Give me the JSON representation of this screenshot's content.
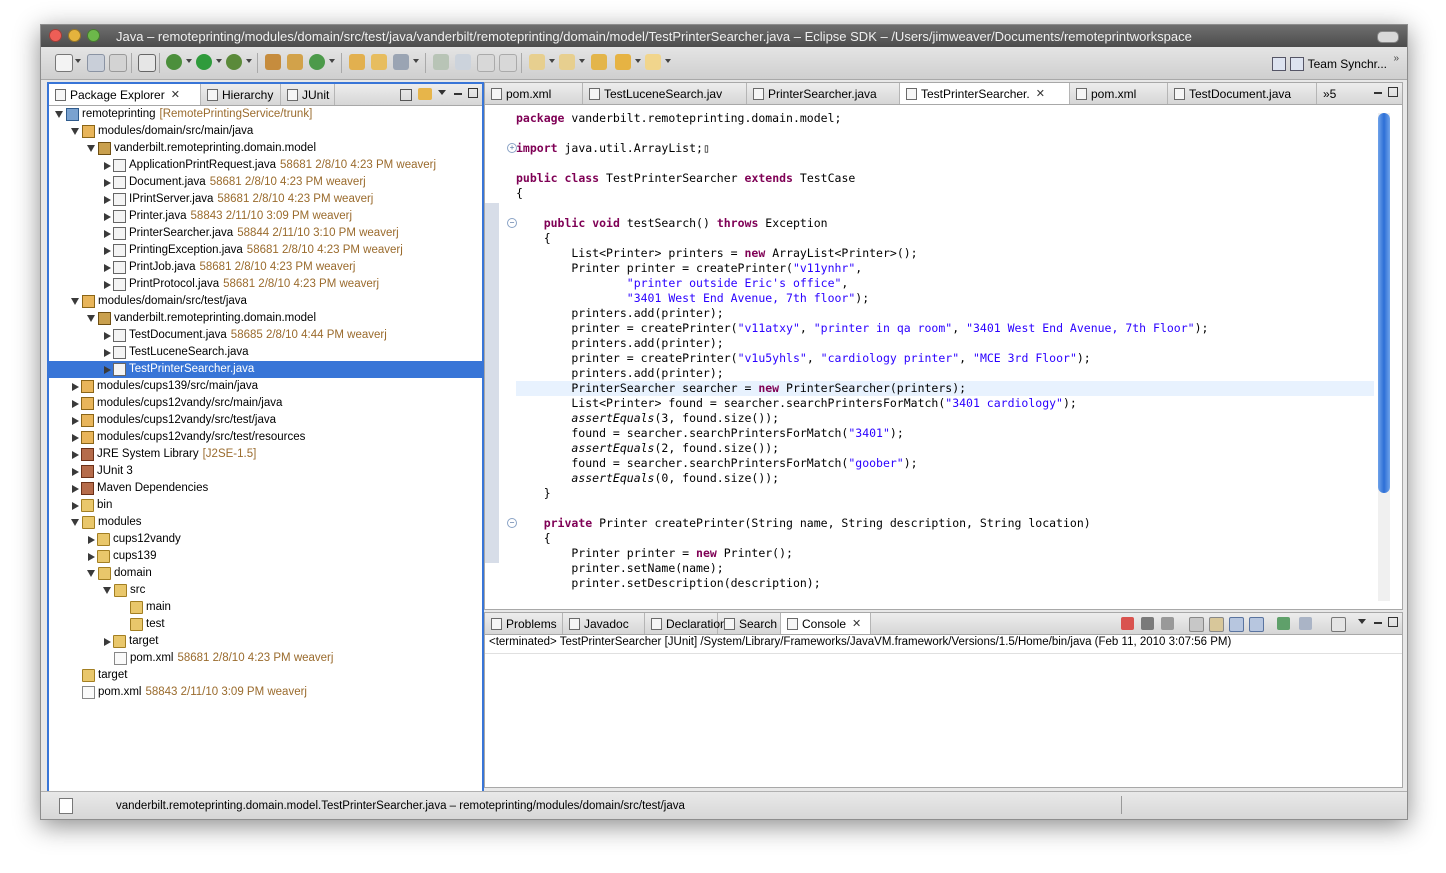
{
  "window": {
    "title": "Java – remoteprinting/modules/domain/src/test/java/vanderbilt/remoteprinting/domain/model/TestPrinterSearcher.java – Eclipse SDK – /Users/jimweaver/Documents/remoteprintworkspace"
  },
  "toolbar": {
    "team_sync_label": "Team Synchr...",
    "chevron": "»"
  },
  "left_tabs": [
    {
      "label": "Package Explorer",
      "active": true
    },
    {
      "label": "Hierarchy",
      "active": false
    },
    {
      "label": "JUnit",
      "active": false
    }
  ],
  "tree": [
    {
      "label": "remoteprinting",
      "deco": "[RemotePrintingService/trunk]",
      "depth": 0,
      "twisty": "open",
      "icon": "proj"
    },
    {
      "label": "modules/domain/src/main/java",
      "deco": "",
      "depth": 1,
      "twisty": "open",
      "icon": "pkgfolder"
    },
    {
      "label": "vanderbilt.remoteprinting.domain.model",
      "deco": "",
      "depth": 2,
      "twisty": "open",
      "icon": "pkg"
    },
    {
      "label": "ApplicationPrintRequest.java",
      "deco": "58681  2/8/10 4:23 PM  weaverj",
      "depth": 3,
      "twisty": "closed",
      "icon": "java"
    },
    {
      "label": "Document.java",
      "deco": "58681  2/8/10 4:23 PM  weaverj",
      "depth": 3,
      "twisty": "closed",
      "icon": "java"
    },
    {
      "label": "IPrintServer.java",
      "deco": "58681  2/8/10 4:23 PM  weaverj",
      "depth": 3,
      "twisty": "closed",
      "icon": "java"
    },
    {
      "label": "Printer.java",
      "deco": "58843  2/11/10 3:09 PM  weaverj",
      "depth": 3,
      "twisty": "closed",
      "icon": "java"
    },
    {
      "label": "PrinterSearcher.java",
      "deco": "58844  2/11/10 3:10 PM  weaverj",
      "depth": 3,
      "twisty": "closed",
      "icon": "java"
    },
    {
      "label": "PrintingException.java",
      "deco": "58681  2/8/10 4:23 PM  weaverj",
      "depth": 3,
      "twisty": "closed",
      "icon": "java"
    },
    {
      "label": "PrintJob.java",
      "deco": "58681  2/8/10 4:23 PM  weaverj",
      "depth": 3,
      "twisty": "closed",
      "icon": "java"
    },
    {
      "label": "PrintProtocol.java",
      "deco": "58681  2/8/10 4:23 PM  weaverj",
      "depth": 3,
      "twisty": "closed",
      "icon": "java"
    },
    {
      "label": "modules/domain/src/test/java",
      "deco": "",
      "depth": 1,
      "twisty": "open",
      "icon": "pkgfolder"
    },
    {
      "label": "vanderbilt.remoteprinting.domain.model",
      "deco": "",
      "depth": 2,
      "twisty": "open",
      "icon": "pkg"
    },
    {
      "label": "TestDocument.java",
      "deco": "58685  2/8/10 4:44 PM  weaverj",
      "depth": 3,
      "twisty": "closed",
      "icon": "java"
    },
    {
      "label": "TestLuceneSearch.java",
      "deco": "",
      "depth": 3,
      "twisty": "closed",
      "icon": "java"
    },
    {
      "label": "TestPrinterSearcher.java",
      "deco": "",
      "depth": 3,
      "twisty": "closed",
      "icon": "java",
      "selected": true
    },
    {
      "label": "modules/cups139/src/main/java",
      "deco": "",
      "depth": 1,
      "twisty": "closed",
      "icon": "pkgfolder"
    },
    {
      "label": "modules/cups12vandy/src/main/java",
      "deco": "",
      "depth": 1,
      "twisty": "closed",
      "icon": "pkgfolder"
    },
    {
      "label": "modules/cups12vandy/src/test/java",
      "deco": "",
      "depth": 1,
      "twisty": "closed",
      "icon": "pkgfolder"
    },
    {
      "label": "modules/cups12vandy/src/test/resources",
      "deco": "",
      "depth": 1,
      "twisty": "closed",
      "icon": "pkgfolder"
    },
    {
      "label": "JRE System Library",
      "deco": "[J2SE-1.5]",
      "depth": 1,
      "twisty": "closed",
      "icon": "lib"
    },
    {
      "label": "JUnit 3",
      "deco": "",
      "depth": 1,
      "twisty": "closed",
      "icon": "lib"
    },
    {
      "label": "Maven Dependencies",
      "deco": "",
      "depth": 1,
      "twisty": "closed",
      "icon": "lib"
    },
    {
      "label": "bin",
      "deco": "",
      "depth": 1,
      "twisty": "closed",
      "icon": "folder"
    },
    {
      "label": "modules",
      "deco": "",
      "depth": 1,
      "twisty": "open",
      "icon": "folder"
    },
    {
      "label": "cups12vandy",
      "deco": "",
      "depth": 2,
      "twisty": "closed",
      "icon": "folder"
    },
    {
      "label": "cups139",
      "deco": "",
      "depth": 2,
      "twisty": "closed",
      "icon": "folder"
    },
    {
      "label": "domain",
      "deco": "",
      "depth": 2,
      "twisty": "open",
      "icon": "folder"
    },
    {
      "label": "src",
      "deco": "",
      "depth": 3,
      "twisty": "open",
      "icon": "folder"
    },
    {
      "label": "main",
      "deco": "",
      "depth": 4,
      "twisty": "none",
      "icon": "folder"
    },
    {
      "label": "test",
      "deco": "",
      "depth": 4,
      "twisty": "none",
      "icon": "folder"
    },
    {
      "label": "target",
      "deco": "",
      "depth": 3,
      "twisty": "closed",
      "icon": "folder"
    },
    {
      "label": "pom.xml",
      "deco": "58681  2/8/10 4:23 PM  weaverj",
      "depth": 3,
      "twisty": "none",
      "icon": "xml"
    },
    {
      "label": "target",
      "deco": "",
      "depth": 1,
      "twisty": "none",
      "icon": "folder"
    },
    {
      "label": "pom.xml",
      "deco": "58843  2/11/10 3:09 PM  weaverj",
      "depth": 1,
      "twisty": "none",
      "icon": "xml"
    }
  ],
  "editor_tabs": [
    {
      "label": "pom.xml",
      "active": false
    },
    {
      "label": "TestLuceneSearch.jav",
      "active": false
    },
    {
      "label": "PrinterSearcher.java",
      "active": false
    },
    {
      "label": "TestPrinterSearcher.",
      "active": true
    },
    {
      "label": "pom.xml",
      "active": false
    },
    {
      "label": "TestDocument.java",
      "active": false
    }
  ],
  "editor_overflow": "»5",
  "code_lines": [
    {
      "html": "<span class=\"kw\">package</span> vanderbilt.remoteprinting.domain.model;"
    },
    {
      "html": ""
    },
    {
      "html": "<span class=\"kw\">import</span> java.util.ArrayList;▯",
      "fold": "plus"
    },
    {
      "html": ""
    },
    {
      "html": "<span class=\"kw\">public</span> <span class=\"kw\">class</span> TestPrinterSearcher <span class=\"kw\">extends</span> TestCase"
    },
    {
      "html": "{"
    },
    {
      "html": ""
    },
    {
      "html": "    <span class=\"kw\">public</span> <span class=\"kw\">void</span> testSearch() <span class=\"kw\">throws</span> Exception",
      "fold": "minus"
    },
    {
      "html": "    {"
    },
    {
      "html": "        List&lt;Printer&gt; printers = <span class=\"kw\">new</span> ArrayList&lt;Printer&gt;();"
    },
    {
      "html": "        Printer printer = createPrinter(<span class=\"str\">\"v11ynhr\"</span>,"
    },
    {
      "html": "                <span class=\"str\">\"printer outside Eric's office\"</span>,"
    },
    {
      "html": "                <span class=\"str\">\"3401 West End Avenue, 7th floor\"</span>);"
    },
    {
      "html": "        printers.add(printer);"
    },
    {
      "html": "        printer = createPrinter(<span class=\"str\">\"v11atxy\"</span>, <span class=\"str\">\"printer in qa room\"</span>, <span class=\"str\">\"3401 West End Avenue, 7th Floor\"</span>);"
    },
    {
      "html": "        printers.add(printer);"
    },
    {
      "html": "        printer = createPrinter(<span class=\"str\">\"v1u5yhls\"</span>, <span class=\"str\">\"cardiology printer\"</span>, <span class=\"str\">\"MCE 3rd Floor\"</span>);"
    },
    {
      "html": "        printers.add(printer);"
    },
    {
      "html": "        PrinterSearcher searcher = <span class=\"kw\">new</span> PrinterSearcher(printers);",
      "highlight": true
    },
    {
      "html": "        List&lt;Printer&gt; found = searcher.searchPrintersForMatch(<span class=\"str\">\"3401 cardiology\"</span>);"
    },
    {
      "html": "        <span class=\"it\">assertEquals</span>(3, found.size());"
    },
    {
      "html": "        found = searcher.searchPrintersForMatch(<span class=\"str\">\"3401\"</span>);"
    },
    {
      "html": "        <span class=\"it\">assertEquals</span>(2, found.size());"
    },
    {
      "html": "        found = searcher.searchPrintersForMatch(<span class=\"str\">\"goober\"</span>);"
    },
    {
      "html": "        <span class=\"it\">assertEquals</span>(0, found.size());"
    },
    {
      "html": "    }"
    },
    {
      "html": ""
    },
    {
      "html": "    <span class=\"kw\">private</span> Printer createPrinter(String name, String description, String location)",
      "fold": "minus"
    },
    {
      "html": "    {"
    },
    {
      "html": "        Printer printer = <span class=\"kw\">new</span> Printer();"
    },
    {
      "html": "        printer.setName(name);"
    },
    {
      "html": "        printer.setDescription(description);"
    }
  ],
  "console_tabs": [
    {
      "label": "Problems",
      "active": false
    },
    {
      "label": "Javadoc",
      "active": false
    },
    {
      "label": "Declaration",
      "active": false
    },
    {
      "label": "Search",
      "active": false
    },
    {
      "label": "Console",
      "active": true
    }
  ],
  "console": {
    "header": "<terminated> TestPrinterSearcher [JUnit] /System/Library/Frameworks/JavaVM.framework/Versions/1.5/Home/bin/java (Feb 11, 2010 3:07:56 PM)"
  },
  "status": {
    "text": "vanderbilt.remoteprinting.domain.model.TestPrinterSearcher.java – remoteprinting/modules/domain/src/test/java"
  },
  "colors": {
    "selection": "#3875d7",
    "keyword": "#7f0055",
    "string": "#2a00ff",
    "decoration": "#9a6b2d"
  }
}
